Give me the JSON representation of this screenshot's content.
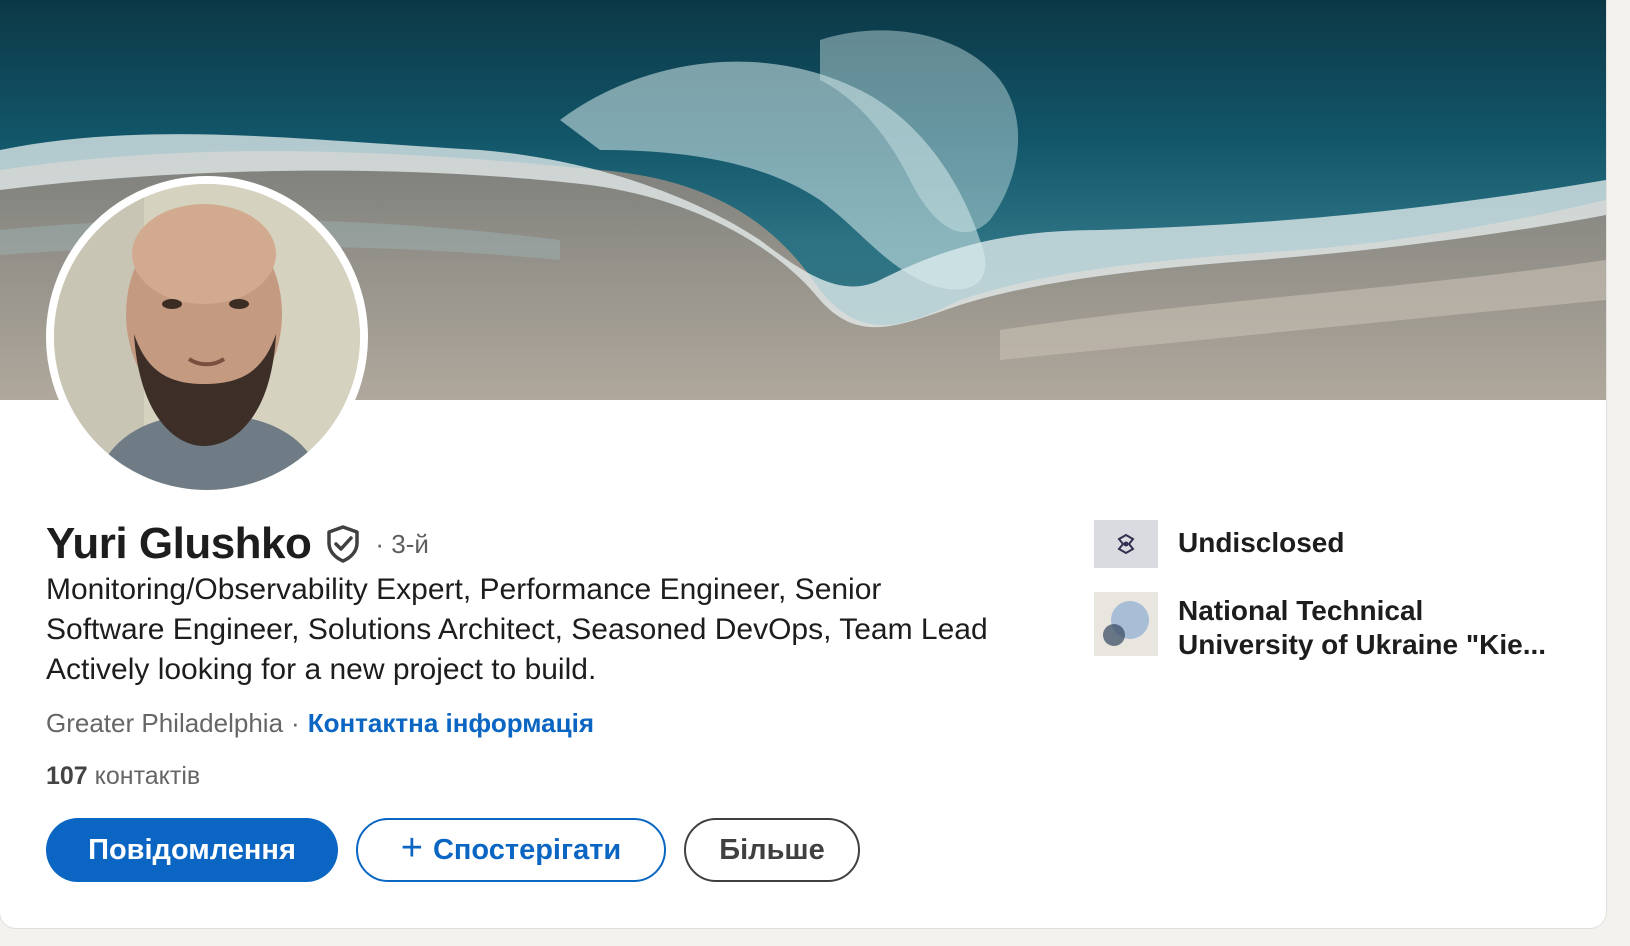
{
  "profile": {
    "name": "Yuri Glushko",
    "degree": "· 3-й",
    "headline": "Monitoring/Observability Expert, Performance Engineer, Senior Software Engineer, Solutions Architect, Seasoned DevOps, Team Lead Actively looking for a new project to build.",
    "location": "Greater Philadelphia",
    "separator": "·",
    "contact_info_label": "Контактна інформація",
    "connections_count": "107",
    "connections_label": "контактів"
  },
  "actions": {
    "message_label": "Повідомлення",
    "follow_plus": "+",
    "follow_label": "Спостерігати",
    "more_label": "Більше"
  },
  "sidebar": {
    "items": [
      {
        "label": "Undisclosed",
        "icon": "company-logo-icon"
      },
      {
        "label": "National Technical University of Ukraine \"Kie...",
        "icon": "university-logo-icon"
      }
    ]
  },
  "colors": {
    "accent": "#0a66c2",
    "text": "#1d1d1d",
    "muted": "#666666"
  }
}
